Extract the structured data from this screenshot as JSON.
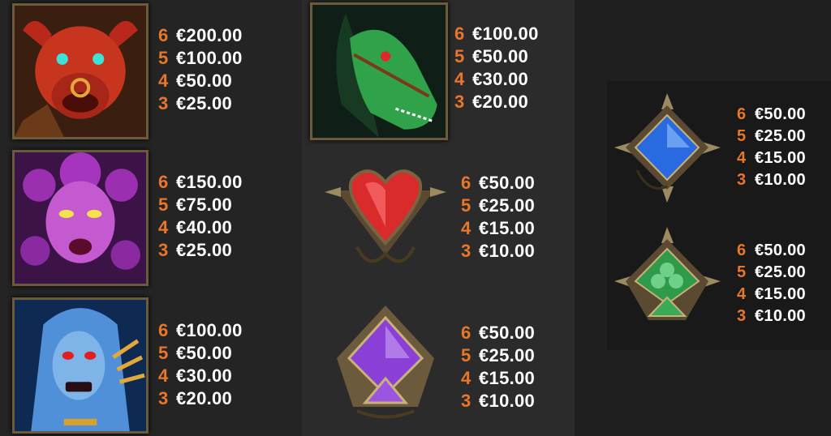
{
  "colors": {
    "count": "#e8772a",
    "value": "#ffffff"
  },
  "symbols": [
    {
      "name": "red-bull-demon",
      "icon": "red-bull-demon-icon",
      "pays": [
        {
          "count": "6",
          "value": "€200.00"
        },
        {
          "count": "5",
          "value": "€100.00"
        },
        {
          "count": "4",
          "value": "€50.00"
        },
        {
          "count": "3",
          "value": "€25.00"
        }
      ]
    },
    {
      "name": "medusa",
      "icon": "medusa-icon",
      "pays": [
        {
          "count": "6",
          "value": "€150.00"
        },
        {
          "count": "5",
          "value": "€75.00"
        },
        {
          "count": "4",
          "value": "€40.00"
        },
        {
          "count": "3",
          "value": "€25.00"
        }
      ]
    },
    {
      "name": "blue-ghoul",
      "icon": "blue-ghoul-icon",
      "pays": [
        {
          "count": "6",
          "value": "€100.00"
        },
        {
          "count": "5",
          "value": "€50.00"
        },
        {
          "count": "4",
          "value": "€30.00"
        },
        {
          "count": "3",
          "value": "€20.00"
        }
      ]
    },
    {
      "name": "green-horse",
      "icon": "green-horse-icon",
      "pays": [
        {
          "count": "6",
          "value": "€100.00"
        },
        {
          "count": "5",
          "value": "€50.00"
        },
        {
          "count": "4",
          "value": "€30.00"
        },
        {
          "count": "3",
          "value": "€20.00"
        }
      ]
    },
    {
      "name": "red-heart",
      "icon": "heart-gem-icon",
      "pays": [
        {
          "count": "6",
          "value": "€50.00"
        },
        {
          "count": "5",
          "value": "€25.00"
        },
        {
          "count": "4",
          "value": "€15.00"
        },
        {
          "count": "3",
          "value": "€10.00"
        }
      ]
    },
    {
      "name": "purple-spade",
      "icon": "spade-gem-icon",
      "pays": [
        {
          "count": "6",
          "value": "€50.00"
        },
        {
          "count": "5",
          "value": "€25.00"
        },
        {
          "count": "4",
          "value": "€15.00"
        },
        {
          "count": "3",
          "value": "€10.00"
        }
      ]
    },
    {
      "name": "blue-diamond",
      "icon": "diamond-gem-icon",
      "pays": [
        {
          "count": "6",
          "value": "€50.00"
        },
        {
          "count": "5",
          "value": "€25.00"
        },
        {
          "count": "4",
          "value": "€15.00"
        },
        {
          "count": "3",
          "value": "€10.00"
        }
      ]
    },
    {
      "name": "green-club",
      "icon": "club-gem-icon",
      "pays": [
        {
          "count": "6",
          "value": "€50.00"
        },
        {
          "count": "5",
          "value": "€25.00"
        },
        {
          "count": "4",
          "value": "€15.00"
        },
        {
          "count": "3",
          "value": "€10.00"
        }
      ]
    }
  ]
}
